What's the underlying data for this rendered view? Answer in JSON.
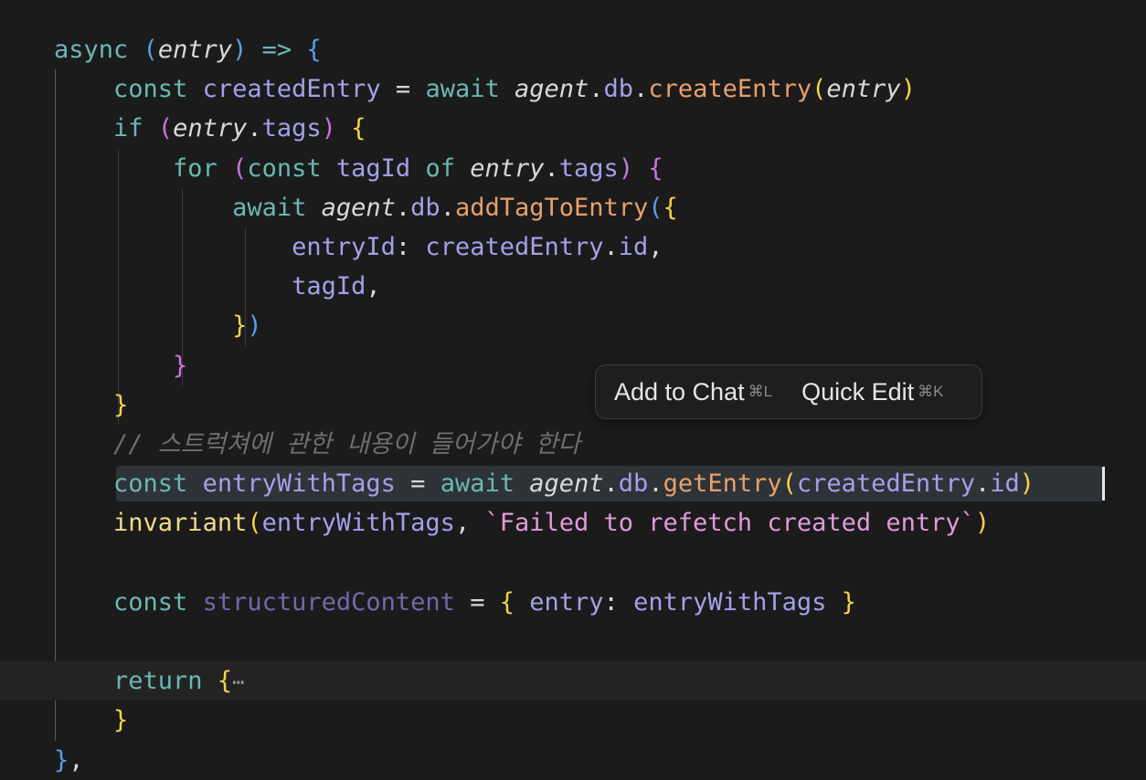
{
  "editor": {
    "lines": [
      {
        "tokens": [
          {
            "t": "async",
            "c": "#6ab8b2"
          },
          {
            "t": " "
          },
          {
            "t": "(",
            "c": "#5aa0e6"
          },
          {
            "t": "entry",
            "c": "#d8d8d8",
            "i": true
          },
          {
            "t": ")",
            "c": "#5aa0e6"
          },
          {
            "t": " "
          },
          {
            "t": "=>",
            "c": "#6ab8b2"
          },
          {
            "t": " "
          },
          {
            "t": "{",
            "c": "#5aa0e6"
          }
        ]
      },
      {
        "tokens": [
          {
            "t": "    "
          },
          {
            "t": "const",
            "c": "#6ab8b2"
          },
          {
            "t": " "
          },
          {
            "t": "createdEntry",
            "c": "#a4a0e8"
          },
          {
            "t": " "
          },
          {
            "t": "=",
            "c": "#d8d8d8"
          },
          {
            "t": " "
          },
          {
            "t": "await",
            "c": "#6ab8b2"
          },
          {
            "t": " "
          },
          {
            "t": "agent",
            "c": "#d8d8d8",
            "i": true
          },
          {
            "t": ".",
            "c": "#d8d8d8"
          },
          {
            "t": "db",
            "c": "#a4a0e8"
          },
          {
            "t": ".",
            "c": "#d8d8d8"
          },
          {
            "t": "createEntry",
            "c": "#e8a06a"
          },
          {
            "t": "(",
            "c": "#f5d34a"
          },
          {
            "t": "entry",
            "c": "#d8d8d8",
            "i": true
          },
          {
            "t": ")",
            "c": "#f5d34a"
          }
        ]
      },
      {
        "tokens": [
          {
            "t": "    "
          },
          {
            "t": "if",
            "c": "#6ab8b2"
          },
          {
            "t": " "
          },
          {
            "t": "(",
            "c": "#c678dd"
          },
          {
            "t": "entry",
            "c": "#d8d8d8",
            "i": true
          },
          {
            "t": ".",
            "c": "#d8d8d8"
          },
          {
            "t": "tags",
            "c": "#a4a0e8"
          },
          {
            "t": ")",
            "c": "#c678dd"
          },
          {
            "t": " "
          },
          {
            "t": "{",
            "c": "#f5d34a"
          }
        ]
      },
      {
        "tokens": [
          {
            "t": "        "
          },
          {
            "t": "for",
            "c": "#6ab8b2"
          },
          {
            "t": " "
          },
          {
            "t": "(",
            "c": "#c678dd"
          },
          {
            "t": "const",
            "c": "#6ab8b2"
          },
          {
            "t": " "
          },
          {
            "t": "tagId",
            "c": "#a4a0e8"
          },
          {
            "t": " "
          },
          {
            "t": "of",
            "c": "#6ab8b2"
          },
          {
            "t": " "
          },
          {
            "t": "entry",
            "c": "#d8d8d8",
            "i": true
          },
          {
            "t": ".",
            "c": "#d8d8d8"
          },
          {
            "t": "tags",
            "c": "#a4a0e8"
          },
          {
            "t": ")",
            "c": "#c678dd"
          },
          {
            "t": " "
          },
          {
            "t": "{",
            "c": "#c678dd"
          }
        ]
      },
      {
        "tokens": [
          {
            "t": "            "
          },
          {
            "t": "await",
            "c": "#6ab8b2"
          },
          {
            "t": " "
          },
          {
            "t": "agent",
            "c": "#d8d8d8",
            "i": true
          },
          {
            "t": ".",
            "c": "#d8d8d8"
          },
          {
            "t": "db",
            "c": "#a4a0e8"
          },
          {
            "t": ".",
            "c": "#d8d8d8"
          },
          {
            "t": "addTagToEntry",
            "c": "#e8a06a"
          },
          {
            "t": "(",
            "c": "#5aa0e6"
          },
          {
            "t": "{",
            "c": "#f5d34a"
          }
        ]
      },
      {
        "tokens": [
          {
            "t": "                "
          },
          {
            "t": "entryId",
            "c": "#a4a0e8"
          },
          {
            "t": ":",
            "c": "#d8d8d8"
          },
          {
            "t": " "
          },
          {
            "t": "createdEntry",
            "c": "#a4a0e8"
          },
          {
            "t": ".",
            "c": "#d8d8d8"
          },
          {
            "t": "id",
            "c": "#a4a0e8"
          },
          {
            "t": ",",
            "c": "#d8d8d8"
          }
        ]
      },
      {
        "tokens": [
          {
            "t": "                "
          },
          {
            "t": "tagId",
            "c": "#a4a0e8"
          },
          {
            "t": ",",
            "c": "#d8d8d8"
          }
        ]
      },
      {
        "tokens": [
          {
            "t": "            "
          },
          {
            "t": "}",
            "c": "#f5d34a"
          },
          {
            "t": ")",
            "c": "#5aa0e6"
          }
        ]
      },
      {
        "tokens": [
          {
            "t": "        "
          },
          {
            "t": "}",
            "c": "#c678dd"
          }
        ]
      },
      {
        "tokens": [
          {
            "t": "    "
          },
          {
            "t": "}",
            "c": "#f5d34a"
          }
        ]
      },
      {
        "tokens": [
          {
            "t": "    "
          },
          {
            "t": "// 스트럭쳐에 관한 내용이 들어가야 한다",
            "c": "#6e6e6e",
            "i": true
          }
        ]
      },
      {
        "tokens": [
          {
            "t": "    "
          },
          {
            "t": "const",
            "c": "#6ab8b2"
          },
          {
            "t": " "
          },
          {
            "t": "entryWithTags",
            "c": "#a4a0e8"
          },
          {
            "t": " "
          },
          {
            "t": "=",
            "c": "#d8d8d8"
          },
          {
            "t": " "
          },
          {
            "t": "await",
            "c": "#6ab8b2"
          },
          {
            "t": " "
          },
          {
            "t": "agent",
            "c": "#d8d8d8",
            "i": true
          },
          {
            "t": ".",
            "c": "#d8d8d8"
          },
          {
            "t": "db",
            "c": "#a4a0e8"
          },
          {
            "t": ".",
            "c": "#d8d8d8"
          },
          {
            "t": "getEntry",
            "c": "#e8a06a"
          },
          {
            "t": "(",
            "c": "#f5d34a"
          },
          {
            "t": "createdEntry",
            "c": "#a4a0e8"
          },
          {
            "t": ".",
            "c": "#d8d8d8"
          },
          {
            "t": "id",
            "c": "#a4a0e8"
          },
          {
            "t": ")",
            "c": "#f5d34a"
          }
        ]
      },
      {
        "tokens": [
          {
            "t": "    "
          },
          {
            "t": "invariant",
            "c": "#f0dc8c"
          },
          {
            "t": "(",
            "c": "#f5d34a"
          },
          {
            "t": "entryWithTags",
            "c": "#a4a0e8"
          },
          {
            "t": ",",
            "c": "#d8d8d8"
          },
          {
            "t": " "
          },
          {
            "t": "`Failed to refetch created entry`",
            "c": "#e29ad8"
          },
          {
            "t": ")",
            "c": "#f5d34a"
          }
        ]
      },
      {
        "tokens": []
      },
      {
        "tokens": [
          {
            "t": "    "
          },
          {
            "t": "const",
            "c": "#6ab8b2"
          },
          {
            "t": " "
          },
          {
            "t": "structuredContent",
            "c": "#6f6aa8"
          },
          {
            "t": " "
          },
          {
            "t": "=",
            "c": "#d8d8d8"
          },
          {
            "t": " "
          },
          {
            "t": "{",
            "c": "#f5d34a"
          },
          {
            "t": " "
          },
          {
            "t": "entry",
            "c": "#a4a0e8"
          },
          {
            "t": ":",
            "c": "#d8d8d8"
          },
          {
            "t": " "
          },
          {
            "t": "entryWithTags",
            "c": "#a4a0e8"
          },
          {
            "t": " "
          },
          {
            "t": "}",
            "c": "#f5d34a"
          }
        ]
      },
      {
        "tokens": []
      },
      {
        "tokens": [
          {
            "t": "    "
          },
          {
            "t": "return",
            "c": "#6ab8b2"
          },
          {
            "t": " "
          },
          {
            "t": "{",
            "c": "#f5d34a"
          },
          {
            "t": "⋯",
            "c": "#9a9a9a",
            "fold": true
          }
        ]
      },
      {
        "tokens": [
          {
            "t": "    "
          },
          {
            "t": "}",
            "c": "#f5d34a"
          }
        ]
      },
      {
        "tokens": [
          {
            "t": "}",
            "c": "#5aa0e6"
          },
          {
            "t": ",",
            "c": "#d8d8d8"
          }
        ]
      }
    ],
    "selected_line": 11,
    "current_line": 16
  },
  "popup": {
    "add_to_chat_label": "Add to Chat",
    "add_to_chat_shortcut": "⌘L",
    "quick_edit_label": "Quick Edit",
    "quick_edit_shortcut": "⌘K"
  },
  "colors": {
    "background": "#1b1b1c",
    "keyword": "#6ab8b2",
    "variable": "#a4a0e8",
    "function": "#e8a06a",
    "string": "#e29ad8",
    "comment": "#6e6e6e",
    "bracket_yellow": "#f5d34a",
    "bracket_purple": "#c678dd",
    "bracket_blue": "#5aa0e6"
  }
}
